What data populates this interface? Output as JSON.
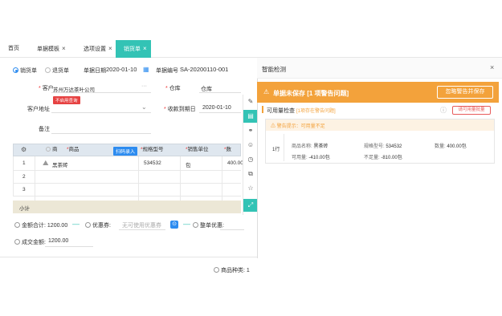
{
  "tabs": [
    {
      "label": "首页",
      "closable": false
    },
    {
      "label": "单据模板",
      "closable": true
    },
    {
      "label": "选项设置",
      "closable": true
    },
    {
      "label": "销货单",
      "closable": true,
      "active": true
    }
  ],
  "doc_type": {
    "option1": "销货单",
    "option2": "退货单",
    "selected": "销货单"
  },
  "header": {
    "date_label": "单据日期",
    "date_value": "2020-01-10",
    "docno_label": "单据编号",
    "docno_value": "SA-20200110-001"
  },
  "form": {
    "customer_label": "客户",
    "customer_value": "苏州万达茶叶公司",
    "customer_badge": "不启用查询",
    "warehouse_label": "仓库",
    "warehouse_value": "仓库",
    "address_label": "客户地址",
    "due_label": "收款到期日",
    "due_value": "2020-01-10",
    "remark_label": "备注"
  },
  "table": {
    "headers": {
      "col_flag": "商",
      "col_product": "商品",
      "scan_btn": "扫码录入",
      "col_spec": "规格型号",
      "col_unit": "销售单位",
      "col_qty": "数"
    },
    "rows": [
      {
        "no": "1",
        "product": "黑茶砖",
        "spec": "534532",
        "unit": "包",
        "qty": "400.00"
      },
      {
        "no": "2",
        "product": "",
        "spec": "",
        "unit": "",
        "qty": ""
      },
      {
        "no": "3",
        "product": "",
        "spec": "",
        "unit": "",
        "qty": ""
      }
    ],
    "sum_label": "小计"
  },
  "totals": {
    "total_label": "金额合计:",
    "total_value": "1200.00",
    "coupon_label": "优惠券:",
    "coupon_placeholder": "无可使用优惠券",
    "promo_label": "整单优惠:",
    "deal_label": "成交金额:",
    "deal_value": "1200.00"
  },
  "footer": {
    "count_label": "商品种类: 1"
  },
  "panel": {
    "title": "智能检测",
    "warn_title": "单据未保存 [1 项警告问题]",
    "warn_btn": "忽略警告并保存",
    "section_title": "可用量检查",
    "section_note": "[1项存在警告问题]",
    "batch_btn": "请可用量批量",
    "alert_text": "警告提示：可用量不足",
    "row_no": "1行",
    "name_label": "商品名称:",
    "name_value": "黑茶砖",
    "spec_label": "规格型号:",
    "spec_value": "534532",
    "qty_label": "数量:",
    "qty_value": "400.00包",
    "avail_label": "可用量:",
    "avail_value": "-410.00包",
    "short_label": "不足量:",
    "short_value": "-810.00包"
  },
  "colors": {
    "teal": "#33c3b5",
    "orange": "#f3a23b",
    "blue": "#2d8cf0",
    "red": "#e64242"
  }
}
